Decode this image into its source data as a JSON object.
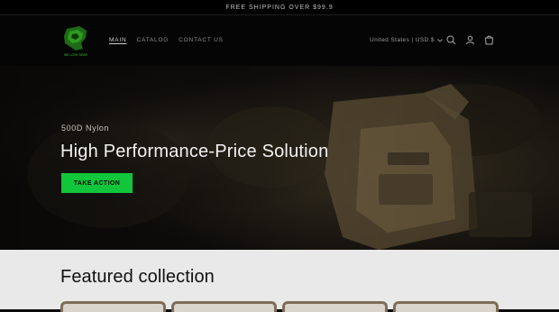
{
  "announcement": {
    "text": "FREE SHIPPING OVER $99.9"
  },
  "header": {
    "logo_text": "WE LOVE GEAR",
    "nav": [
      {
        "label": "MAIN",
        "active": true
      },
      {
        "label": "CATALOG",
        "active": false
      },
      {
        "label": "CONTACT US",
        "active": false
      }
    ],
    "locale": "United States | USD $",
    "icons": [
      "search-icon",
      "account-icon",
      "cart-icon"
    ]
  },
  "hero": {
    "eyebrow": "500D Nylon",
    "headline": "High Performance-Price Solution",
    "cta_label": "TAKE ACTION"
  },
  "featured": {
    "title": "Featured collection",
    "card_count": 4
  },
  "colors": {
    "accent": "#11c63a",
    "header_bg": "#050505",
    "section_bg": "#e9e9e9",
    "card_border": "#7e6d57"
  }
}
